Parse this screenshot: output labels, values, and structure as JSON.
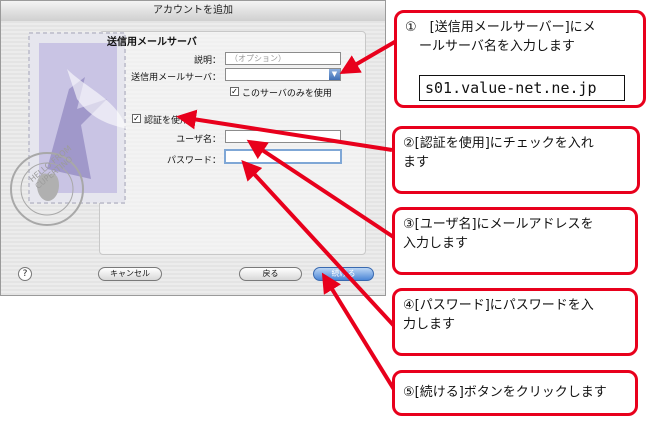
{
  "dialog": {
    "title": "アカウントを追加",
    "section_title": "送信用メールサーバ",
    "description_label": "説明：",
    "description_placeholder": "（オプション）",
    "outgoing_server_label": "送信用メールサーバ：",
    "only_this_server_label": "このサーバのみを使用",
    "use_auth_label": "認証を使用",
    "username_label": "ユーザ名：",
    "password_label": "パスワード：",
    "buttons": {
      "help": "?",
      "cancel": "キャンセル",
      "back": "戻る",
      "continue": "続ける"
    }
  },
  "stamp": {
    "text": "HELLO FROM CUPERTINO"
  },
  "callouts": [
    {
      "id": 1,
      "line1": "①　[送信用メールサーバー]にメ",
      "line2": "ールサーバ名を入力します",
      "server": "s01.value-net.ne.jp"
    },
    {
      "id": 2,
      "line1": "②[認証を使用]にチェックを入れ",
      "line2": "ます"
    },
    {
      "id": 3,
      "line1": "③[ユーザ名]にメールアドレスを",
      "line2": "入力します"
    },
    {
      "id": 4,
      "line1": "④[パスワード]にパスワードを入",
      "line2": "力します"
    },
    {
      "id": 5,
      "line1": "⑤[続ける]ボタンをクリックします"
    }
  ],
  "colors": {
    "annotation_red": "#e8001c",
    "focus_blue": "#7fa7d6",
    "dialog_bg": "#ececec"
  }
}
